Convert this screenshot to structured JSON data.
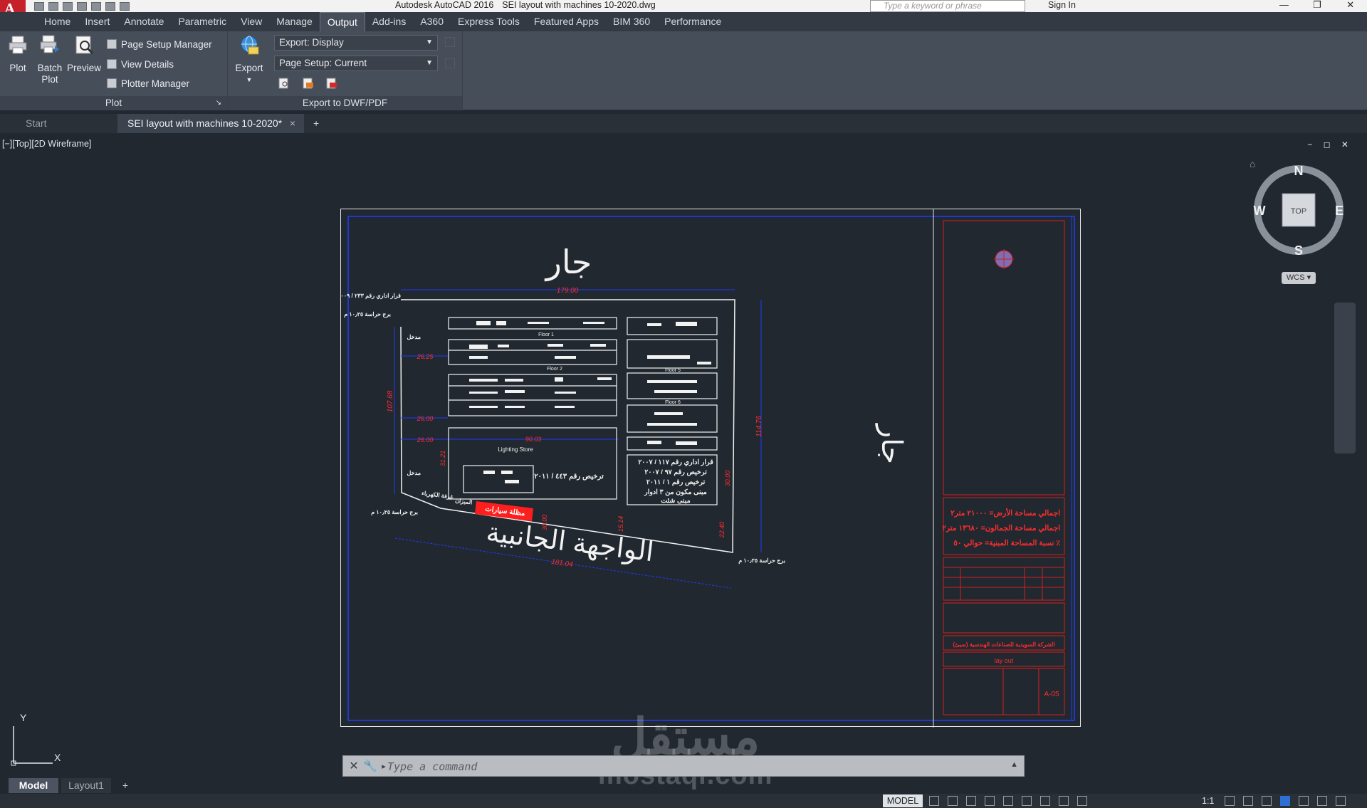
{
  "app": {
    "logo_letter": "A",
    "name": "Autodesk AutoCAD 2016",
    "filename": "SEI layout with machines 10-2020.dwg"
  },
  "search": {
    "placeholder": "Type a keyword or phrase"
  },
  "account": {
    "signin": "Sign In"
  },
  "ribbon_tabs": [
    "Home",
    "Insert",
    "Annotate",
    "Parametric",
    "View",
    "Manage",
    "Output",
    "Add-ins",
    "A360",
    "Express Tools",
    "Featured Apps",
    "BIM 360",
    "Performance"
  ],
  "active_tab": "Output",
  "plot_panel": {
    "title": "Plot",
    "plot": "Plot",
    "batch_plot_1": "Batch",
    "batch_plot_2": "Plot",
    "preview": "Preview",
    "page_setup_manager": "Page Setup Manager",
    "view_details": "View Details",
    "plotter_manager": "Plotter Manager"
  },
  "export_panel": {
    "title": "Export to DWF/PDF",
    "export": "Export",
    "export_combo": "Export: Display",
    "page_setup_combo": "Page Setup: Current"
  },
  "file_tabs": {
    "start": "Start",
    "doc": "SEI layout with machines 10-2020*",
    "close": "×",
    "add": "+"
  },
  "viewport": {
    "label": "[−][Top][2D Wireframe]",
    "controls": "− ◻ ✕"
  },
  "viewcube": {
    "n": "N",
    "s": "S",
    "e": "E",
    "w": "W",
    "face": "TOP",
    "wcs": "WCS ▾"
  },
  "ucs": {
    "y": "Y",
    "x": "X"
  },
  "drawing": {
    "top_label": "جار",
    "right_label": "جار",
    "bottom_label": "الواجهة الجانبية",
    "dim_top": "179.00",
    "dim_left": "107.68",
    "dim_right": "114.76",
    "dim_bottom": "181.04",
    "dim_a": "26.25",
    "dim_b": "26.00",
    "dim_c": "26.00",
    "dim_d": "90.03",
    "dim_e": "31.21",
    "dim_f": "30.00",
    "dim_g": "22.40",
    "dim_h": "15.14",
    "dim_i": "30.00",
    "floor1": "Floor 1",
    "floor2": "Floor 2",
    "floor5": "Floor 5",
    "floor6": "Floor 6",
    "lighting_store": "Lighting Store",
    "license_1": "ترخيص رقم ٤٤٣ / ٢٠١١",
    "decree_top": "قرار اداري رقم ٢٣٣ / ٢٠٠٩",
    "tower_1": "برج حراسة ١٠٫٢٥ م",
    "tower_2": "برج حراسة ١٠٫٢٥ م",
    "tower_3": "برج حراسة ١٠٫٢٥ م",
    "entrance_1": "مدخل",
    "entrance_2": "مدخل",
    "scale_room": "الميزان",
    "elec_room": "غرفة الكهرباء",
    "parking": "مظلة سيارات",
    "building_note_1": "قرار اداري رقم ١١٧ / ٢٠٠٧",
    "building_note_2": "ترخيص رقم ٩٧ / ٢٠٠٧",
    "building_note_3": "ترخيص رقم ١ / ٢٠١١",
    "building_note_4": "مبنى مكون من ٣ ادوار",
    "building_note_5": "مبنى شئت",
    "tb_area_1": "اجمالي مساحة الأرض= ٢١٠٠٠ متر٢",
    "tb_area_2": "اجمالي مساحة الجمالون= ١٣٦٨٠ متر٢",
    "tb_area_3": "نسبة المساحة المبنية= حوالي ٥٠ ٪",
    "tb_company": "الشركة السويدية للصناعات الهندسية (سيئ)",
    "tb_title": "lay out",
    "tb_sheet": "A-05"
  },
  "watermark": {
    "line1": "مستقل",
    "line2": "mostaql.com"
  },
  "command": {
    "placeholder": "Type a command"
  },
  "layout_tabs": {
    "model": "Model",
    "layout1": "Layout1",
    "add": "+"
  },
  "status": {
    "model": "MODEL",
    "scale": "1:1"
  }
}
